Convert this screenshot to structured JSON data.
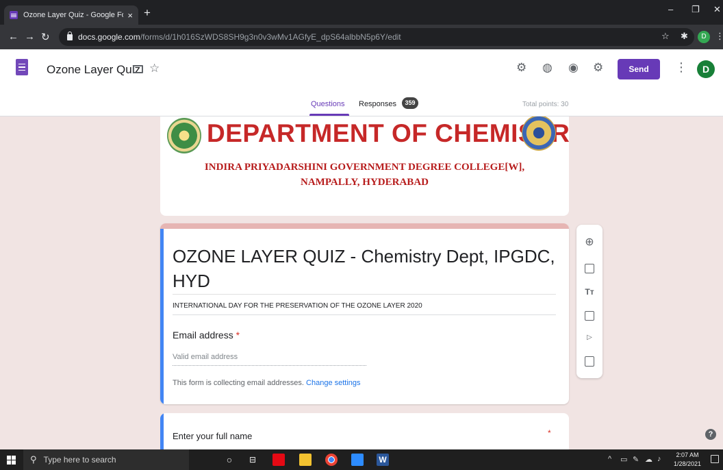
{
  "browser": {
    "tab_title": "Ozone Layer Quiz - Google Form",
    "tab_close": "×",
    "new_tab": "+",
    "url_host": "docs.google.com",
    "url_path": "/forms/d/1h016SzWDS8SH9g3n0v3wMv1AGfyE_dpS64albbN5p6Y/edit",
    "profile_initial": "D"
  },
  "header": {
    "doc_title": "Ozone Layer Quiz",
    "send_label": "Send",
    "avatar_initial": "D",
    "tabs": {
      "questions": "Questions",
      "responses": "Responses",
      "response_count": "359"
    },
    "total_points": "Total points: 30"
  },
  "banner": {
    "department": "DEPARTMENT OF CHEMISTRY",
    "college_line1": "INDIRA PRIYADARSHINI GOVERNMENT DEGREE COLLEGE[W],",
    "college_line2": "NAMPALLY, HYDERABAD"
  },
  "form": {
    "title": "OZONE LAYER QUIZ - Chemistry Dept, IPGDC, HYD",
    "description": "INTERNATIONAL DAY FOR THE PRESERVATION OF THE OZONE LAYER 2020",
    "email_label": "Email address",
    "required_mark": "*",
    "email_placeholder": "Valid email address",
    "collecting_text": "This form is collecting email addresses.",
    "change_settings": "Change settings"
  },
  "questions": [
    {
      "label": "Enter your full name",
      "required_mark": "*"
    }
  ],
  "taskbar": {
    "search_placeholder": "Type here to search",
    "time": "2:07 AM",
    "date": "1/28/2021"
  },
  "colors": {
    "accent": "#673ab7",
    "form_background": "#f1e4e3",
    "card_highlight": "#4285f4",
    "banner_red": "#c62828"
  }
}
